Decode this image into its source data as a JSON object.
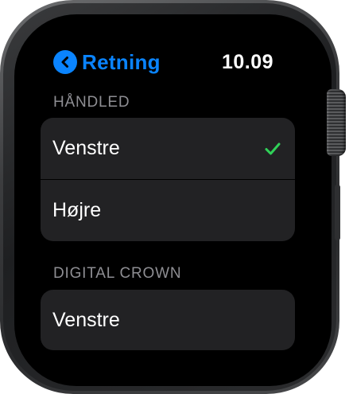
{
  "header": {
    "back_label": "Retning",
    "time": "10.09"
  },
  "sections": [
    {
      "heading": "HÅNDLED",
      "options": [
        {
          "label": "Venstre",
          "selected": true
        },
        {
          "label": "Højre",
          "selected": false
        }
      ]
    },
    {
      "heading": "DIGITAL CROWN",
      "options": [
        {
          "label": "Venstre",
          "selected": false
        }
      ]
    }
  ],
  "colors": {
    "accent_blue": "#0a84ff",
    "checkmark_green": "#30d158",
    "row_background": "#222224",
    "heading_gray": "#8e8e93"
  },
  "icons": {
    "back": "chevron-left-icon",
    "selected": "checkmark-icon"
  }
}
